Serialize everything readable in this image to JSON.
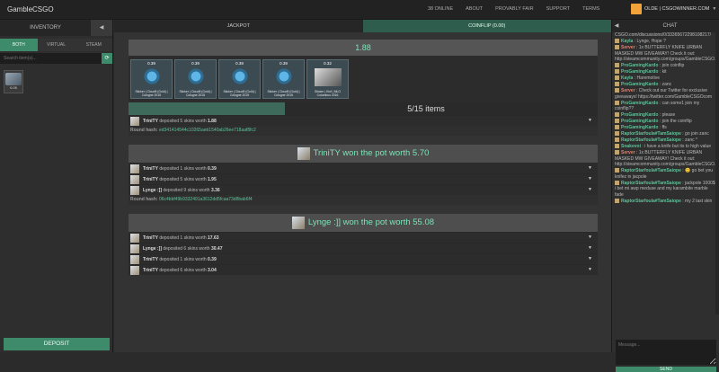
{
  "topbar": {
    "brand": "GambleCSGO",
    "nav": [
      "38 ONLINE",
      "ABOUT",
      "PROVABLY FAIR",
      "SUPPORT",
      "TERMS"
    ],
    "user": "OLDE | CSGOWINNER.COM"
  },
  "inventory": {
    "title": "INVENTORY",
    "collapse_icon": "◀",
    "filters": [
      "BOTH",
      "VIRTUAL",
      "STEAM"
    ],
    "search_placeholder": "Search item(s)...",
    "item_price": "0.05",
    "deposit_label": "DEPOSIT"
  },
  "tabs": [
    "JACKPOT",
    "COINFLIP (0.00)"
  ],
  "current_pot": {
    "value": "1.88",
    "skins": [
      {
        "price": "0.39",
        "name": "Sticker | Cloud9 (Gold) | Cologne 2015"
      },
      {
        "price": "0.39",
        "name": "Sticker | Cloud9 (Gold) | Cologne 2015"
      },
      {
        "price": "0.39",
        "name": "Sticker | Cloud9 (Gold) | Cologne 2015"
      },
      {
        "price": "0.39",
        "name": "Sticker | Cloud9 (Gold) | Cologne 2015"
      },
      {
        "price": "0.32",
        "name": "Sticker | Kinf | MLG Columbus 2016"
      }
    ],
    "progress_label": "5/15 items",
    "progress_fraction": 0.333,
    "deposits": [
      {
        "user": "TriniTY",
        "text": "deposited 5 skins worth",
        "amount": "1.88"
      }
    ],
    "hash_label": "Round hash:",
    "hash": "ed341414544c10265aeb1540ab26ee718aaf8fc2"
  },
  "round2": {
    "headline": "TriniTY won the pot worth 5.70",
    "deposits": [
      {
        "user": "TriniTY",
        "text": "deposited 1 skins worth",
        "amount": "0.39"
      },
      {
        "user": "TriniTY",
        "text": "deposited 5 skins worth",
        "amount": "1.95"
      },
      {
        "user": "Lynge :]]",
        "text": "deposited 9 skins worth",
        "amount": "3.36"
      }
    ],
    "hash_label": "Round hash:",
    "hash": "06c4bbf49b9332491a3612dd5fcaa73d8bab6f4"
  },
  "round3": {
    "headline": "Lynge :]] won the pot worth 55.08",
    "deposits": [
      {
        "user": "TriniTY",
        "text": "deposited 1 skins worth",
        "amount": "17.63"
      },
      {
        "user": "Lynge :]]",
        "text": "deposited 6 skins worth",
        "amount": "30.47"
      },
      {
        "user": "TriniTY",
        "text": "deposited 1 skins worth",
        "amount": "0.39"
      },
      {
        "user": "TriniTY",
        "text": "deposited 6 skins worth",
        "amount": "3.04"
      }
    ]
  },
  "chat": {
    "title": "CHAT",
    "collapse_icon": "◀",
    "messages": [
      {
        "who": "",
        "text": "CSGO.com/discussions/0/33365672298108217/"
      },
      {
        "who": "Kayla",
        "text": " : Lynge, Hope ?"
      },
      {
        "who": "Server",
        "text": " : 1x BUTTERFLY KNIFE URBAN MASKED MW GIVEAWAY! Check it out: http://steamcommunity.com/groups/GambleCSGO.com/discussions/0/33365672298108217/"
      },
      {
        "who": "ProGamingKardo",
        "text": " : join coinflip"
      },
      {
        "who": "ProGamingKardo",
        "text": " : kit"
      },
      {
        "who": "Kayla",
        "text": " : Haremotive"
      },
      {
        "who": "ProGamingKardo",
        "text": " : zanc"
      },
      {
        "who": "Server",
        "text": " : Check out our Twitter for exclusive giveaways! https://twitter.com/GambleCSGOcom"
      },
      {
        "who": "ProGamingKardo",
        "text": " : can some1 join my coinflip??"
      },
      {
        "who": "ProGamingKardo",
        "text": " : please"
      },
      {
        "who": "ProGamingKardo",
        "text": " : join the coinflip"
      },
      {
        "who": "ProGamingKardo",
        "text": " : ffs"
      },
      {
        "who": "RaptorStarfoula#TamSaiope",
        "text": " : go join zanc"
      },
      {
        "who": "RaptorStarfoula#TamSaiope",
        "text": " : zanc *"
      },
      {
        "who": "Snakevoi",
        "text": " : i have a knife but its to high value"
      },
      {
        "who": "Server",
        "text": " : 1x BUTTERFLY KNIFE URBAN MASKED MW GIVEAWAY! Check it out: http://steamcommunity.com/groups/GambleCSGO.com/discussions/0/33365672298108217/"
      },
      {
        "who": "RaptorStarfoula#TamSaiope",
        "text": " : 😊 go bet you knifez in jacpole"
      },
      {
        "who": "RaptorStarfoula#TamSaiope",
        "text": " : jackpole 1000$ i bet mi awp meduse and my karambite marble fade"
      },
      {
        "who": "RaptorStarfoula#TamSaiope",
        "text": " : my 2 last skin"
      }
    ],
    "input_placeholder": "Message...",
    "send_label": "SEND"
  }
}
